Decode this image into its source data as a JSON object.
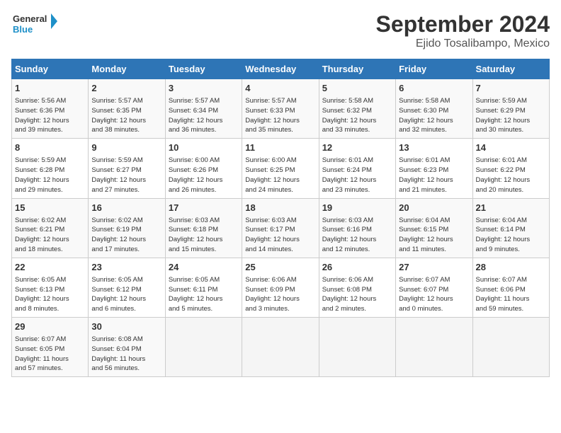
{
  "header": {
    "logo_line1": "General",
    "logo_line2": "Blue",
    "main_title": "September 2024",
    "subtitle": "Ejido Tosalibampo, Mexico"
  },
  "days_of_week": [
    "Sunday",
    "Monday",
    "Tuesday",
    "Wednesday",
    "Thursday",
    "Friday",
    "Saturday"
  ],
  "weeks": [
    [
      {
        "day": "1",
        "info": "Sunrise: 5:56 AM\nSunset: 6:36 PM\nDaylight: 12 hours\nand 39 minutes."
      },
      {
        "day": "2",
        "info": "Sunrise: 5:57 AM\nSunset: 6:35 PM\nDaylight: 12 hours\nand 38 minutes."
      },
      {
        "day": "3",
        "info": "Sunrise: 5:57 AM\nSunset: 6:34 PM\nDaylight: 12 hours\nand 36 minutes."
      },
      {
        "day": "4",
        "info": "Sunrise: 5:57 AM\nSunset: 6:33 PM\nDaylight: 12 hours\nand 35 minutes."
      },
      {
        "day": "5",
        "info": "Sunrise: 5:58 AM\nSunset: 6:32 PM\nDaylight: 12 hours\nand 33 minutes."
      },
      {
        "day": "6",
        "info": "Sunrise: 5:58 AM\nSunset: 6:30 PM\nDaylight: 12 hours\nand 32 minutes."
      },
      {
        "day": "7",
        "info": "Sunrise: 5:59 AM\nSunset: 6:29 PM\nDaylight: 12 hours\nand 30 minutes."
      }
    ],
    [
      {
        "day": "8",
        "info": "Sunrise: 5:59 AM\nSunset: 6:28 PM\nDaylight: 12 hours\nand 29 minutes."
      },
      {
        "day": "9",
        "info": "Sunrise: 5:59 AM\nSunset: 6:27 PM\nDaylight: 12 hours\nand 27 minutes."
      },
      {
        "day": "10",
        "info": "Sunrise: 6:00 AM\nSunset: 6:26 PM\nDaylight: 12 hours\nand 26 minutes."
      },
      {
        "day": "11",
        "info": "Sunrise: 6:00 AM\nSunset: 6:25 PM\nDaylight: 12 hours\nand 24 minutes."
      },
      {
        "day": "12",
        "info": "Sunrise: 6:01 AM\nSunset: 6:24 PM\nDaylight: 12 hours\nand 23 minutes."
      },
      {
        "day": "13",
        "info": "Sunrise: 6:01 AM\nSunset: 6:23 PM\nDaylight: 12 hours\nand 21 minutes."
      },
      {
        "day": "14",
        "info": "Sunrise: 6:01 AM\nSunset: 6:22 PM\nDaylight: 12 hours\nand 20 minutes."
      }
    ],
    [
      {
        "day": "15",
        "info": "Sunrise: 6:02 AM\nSunset: 6:21 PM\nDaylight: 12 hours\nand 18 minutes."
      },
      {
        "day": "16",
        "info": "Sunrise: 6:02 AM\nSunset: 6:19 PM\nDaylight: 12 hours\nand 17 minutes."
      },
      {
        "day": "17",
        "info": "Sunrise: 6:03 AM\nSunset: 6:18 PM\nDaylight: 12 hours\nand 15 minutes."
      },
      {
        "day": "18",
        "info": "Sunrise: 6:03 AM\nSunset: 6:17 PM\nDaylight: 12 hours\nand 14 minutes."
      },
      {
        "day": "19",
        "info": "Sunrise: 6:03 AM\nSunset: 6:16 PM\nDaylight: 12 hours\nand 12 minutes."
      },
      {
        "day": "20",
        "info": "Sunrise: 6:04 AM\nSunset: 6:15 PM\nDaylight: 12 hours\nand 11 minutes."
      },
      {
        "day": "21",
        "info": "Sunrise: 6:04 AM\nSunset: 6:14 PM\nDaylight: 12 hours\nand 9 minutes."
      }
    ],
    [
      {
        "day": "22",
        "info": "Sunrise: 6:05 AM\nSunset: 6:13 PM\nDaylight: 12 hours\nand 8 minutes."
      },
      {
        "day": "23",
        "info": "Sunrise: 6:05 AM\nSunset: 6:12 PM\nDaylight: 12 hours\nand 6 minutes."
      },
      {
        "day": "24",
        "info": "Sunrise: 6:05 AM\nSunset: 6:11 PM\nDaylight: 12 hours\nand 5 minutes."
      },
      {
        "day": "25",
        "info": "Sunrise: 6:06 AM\nSunset: 6:09 PM\nDaylight: 12 hours\nand 3 minutes."
      },
      {
        "day": "26",
        "info": "Sunrise: 6:06 AM\nSunset: 6:08 PM\nDaylight: 12 hours\nand 2 minutes."
      },
      {
        "day": "27",
        "info": "Sunrise: 6:07 AM\nSunset: 6:07 PM\nDaylight: 12 hours\nand 0 minutes."
      },
      {
        "day": "28",
        "info": "Sunrise: 6:07 AM\nSunset: 6:06 PM\nDaylight: 11 hours\nand 59 minutes."
      }
    ],
    [
      {
        "day": "29",
        "info": "Sunrise: 6:07 AM\nSunset: 6:05 PM\nDaylight: 11 hours\nand 57 minutes."
      },
      {
        "day": "30",
        "info": "Sunrise: 6:08 AM\nSunset: 6:04 PM\nDaylight: 11 hours\nand 56 minutes."
      },
      {
        "day": "",
        "info": ""
      },
      {
        "day": "",
        "info": ""
      },
      {
        "day": "",
        "info": ""
      },
      {
        "day": "",
        "info": ""
      },
      {
        "day": "",
        "info": ""
      }
    ]
  ]
}
